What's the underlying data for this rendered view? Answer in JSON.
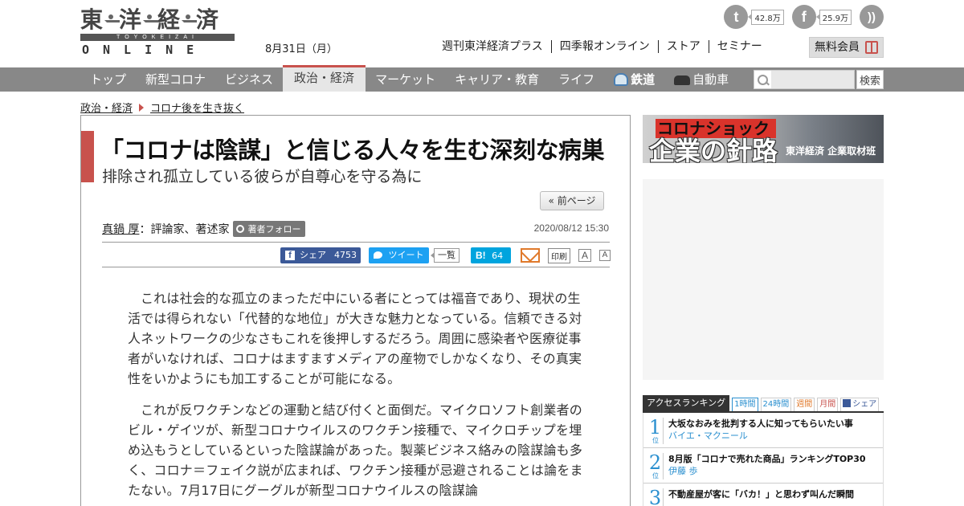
{
  "header": {
    "logo_kanji": [
      "東",
      "洋",
      "経",
      "済"
    ],
    "logo_sub": "TOYOKEIZAI",
    "logo_online": "ONLINE",
    "date": "8月31日（月）",
    "social": [
      {
        "icon": "twitter-icon",
        "count": "42.8万"
      },
      {
        "icon": "facebook-icon",
        "count": "25.9万"
      },
      {
        "icon": "rss-icon",
        "count": ""
      }
    ],
    "top_links": [
      "週刊東洋経済プラス",
      "四季報オンライン",
      "ストア",
      "セミナー"
    ],
    "member_label": "無料会員"
  },
  "nav": {
    "items": [
      {
        "label": "トップ",
        "active": false
      },
      {
        "label": "新型コロナ",
        "active": false
      },
      {
        "label": "ビジネス",
        "active": false
      },
      {
        "label": "政治・経済",
        "active": true
      },
      {
        "label": "マーケット",
        "active": false
      },
      {
        "label": "キャリア・教育",
        "active": false
      },
      {
        "label": "ライフ",
        "active": false
      }
    ],
    "rail_label": "鉄道",
    "car_label": "自動車",
    "search_placeholder": "",
    "search_button": "検索"
  },
  "breadcrumb": [
    "政治・経済",
    "コロナ後を生き抜く"
  ],
  "article": {
    "title": "「コロナは陰謀」と信じる人々を生む深刻な病巣",
    "subtitle": "排除され孤立している彼らが自尊心を守る為に",
    "prev_page": "« 前ページ",
    "author_name": "真鍋 厚",
    "author_role": "評論家、著述家",
    "follow_label": "著者フォロー",
    "date": "2020/08/12 15:30",
    "share": {
      "fb_label": "シェア",
      "fb_count": "4753",
      "tw_label": "ツイート",
      "list_label": "一覧",
      "hb_label": "B!",
      "hb_count": "64",
      "print_label": "印刷",
      "font_large": "A",
      "font_small": "A"
    },
    "paragraphs": [
      "これは社会的な孤立のまっただ中にいる者にとっては福音であり、現状の生活では得られない「代替的な地位」が大きな魅力となっている。信頼できる対人ネットワークの少なさもこれを後押しするだろう。周囲に感染者や医療従事者がいなければ、コロナはますますメディアの産物でしかなくなり、その真実性をいかようにも加工することが可能になる。",
      "これが反ワクチンなどの運動と結び付くと面倒だ。マイクロソフト創業者のビル・ゲイツが、新型コロナウイルスのワクチン接種で、マイクロチップを埋め込もうとしているといった陰謀論があった。製薬ビジネス絡みの陰謀論も多く、コロナ＝フェイク説が広まれば、ワクチン接種が忌避されることは論をまたない。7月17日にグーグルが新型コロナウイルスの陰謀論"
    ]
  },
  "sidebar": {
    "banner_top": "コロナショック",
    "banner_main": "企業の針路",
    "banner_credit": "東洋経済 企業取材班",
    "ranking_title": "アクセスランキング",
    "ranking_tabs": [
      "1時間",
      "24時間",
      "週間",
      "月間",
      "シェア"
    ],
    "ranking_unit": "位",
    "ranking": [
      {
        "rank": "1",
        "title": "大坂なおみを批判する人に知ってもらいたい事",
        "author": "バイエ・マクニール"
      },
      {
        "rank": "2",
        "title": "8月版「コロナで売れた商品」ランキングTOP30",
        "author": "伊藤 歩"
      },
      {
        "rank": "3",
        "title": "不動産屋が客に「バカ！」と思わず叫んだ瞬間",
        "author": ""
      }
    ]
  }
}
